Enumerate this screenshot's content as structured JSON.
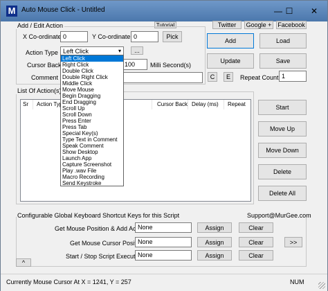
{
  "window": {
    "title": "Auto Mouse Click - Untitled",
    "icon_letter": "M",
    "minimize": "—",
    "maximize": "☐",
    "close": "✕"
  },
  "top_links": {
    "tutorial": "Tutorial",
    "twitter": "Twitter",
    "google": "Google +",
    "facebook": "Facebook"
  },
  "add_edit": {
    "group_label": "Add / Edit Action",
    "x_label": "X Co-ordinate :",
    "x_value": "0",
    "y_label": "Y Co-ordinate :",
    "y_value": "0",
    "pick_label": "Pick",
    "action_type_label": "Action Type :",
    "action_type_value": "Left Click",
    "more_label": "...",
    "cursor_back_label": "Cursor Back :",
    "delay_value": "100",
    "delay_unit": "Milli Second(s)",
    "comment_label": "Comment :",
    "comment_value": "",
    "c_label": "C",
    "e_label": "E",
    "repeat_label": "Repeat Count :",
    "repeat_value": "1"
  },
  "actions": {
    "add": "Add",
    "load": "Load",
    "update": "Update",
    "save": "Save"
  },
  "list": {
    "group_label": "List Of Action(s) to E",
    "columns": [
      "Sr",
      "Action Typ",
      "Cursor Back",
      "Delay (ms)",
      "Repeat"
    ]
  },
  "list_buttons": {
    "start": "Start",
    "move_up": "Move Up",
    "move_down": "Move Down",
    "delete": "Delete",
    "delete_all": "Delete All"
  },
  "dropdown": {
    "items": [
      "Left Click",
      "Right Click",
      "Double Click",
      "Double Right Click",
      "Middle Click",
      "Move Mouse",
      "Begin Dragging",
      "End Dragging",
      "Scroll Up",
      "Scroll Down",
      "Press Enter",
      "Press Tab",
      "Special Key(s)",
      "Type Text in Comment",
      "Speak Comment",
      "Show Desktop",
      "Launch App",
      "Capture Screenshot",
      "Play .wav File",
      "Macro Recording",
      "Send Keystroke"
    ]
  },
  "shortcuts": {
    "header": "Configurable Global Keyboard Shortcut Keys for this Script",
    "support": "Support@MurGee.com",
    "rows": [
      {
        "label": "Get Mouse Position & Add Action :",
        "value": "None",
        "assign": "Assign",
        "clear": "Clear"
      },
      {
        "label": "Get Mouse Cursor Position :",
        "value": "None",
        "assign": "Assign",
        "clear": "Clear"
      },
      {
        "label": "Start / Stop Script Execution :",
        "value": "None",
        "assign": "Assign",
        "clear": "Clear"
      }
    ],
    "more": ">>",
    "collapse": "^"
  },
  "status": {
    "text": "Currently Mouse Cursor At X = 1241, Y = 257",
    "num": "NUM"
  }
}
